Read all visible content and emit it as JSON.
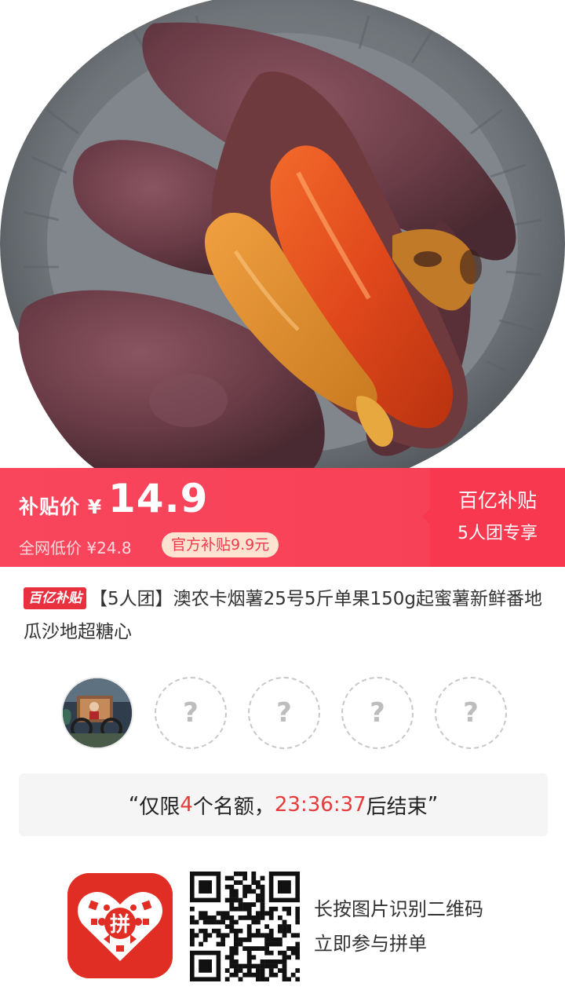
{
  "hero": {
    "image": "roasted-sweet-potatoes-on-tray"
  },
  "banner": {
    "subsidy_label": "补贴价",
    "currency": "¥",
    "price": "14.9",
    "market_label": "全网低价",
    "market_price": "¥24.8",
    "official_badge": "官方补贴9.9元",
    "program_title": "百亿补贴",
    "group_label": "5人团专享"
  },
  "product": {
    "badge": "百亿补贴",
    "title": "【5人团】澳农卡烟薯25号5斤单果150g起蜜薯新鲜番地瓜沙地超糖心"
  },
  "group": {
    "joined": 1,
    "slots": 5,
    "empty_mark": "?"
  },
  "notice": {
    "open_quote": "“",
    "prefix": "仅限",
    "count": "4",
    "middle": "个名额，",
    "timer": "23:36:37",
    "suffix": "后结束",
    "close_quote": "”"
  },
  "footer": {
    "app_icon": "pinduoduo-logo",
    "logo_text": "拼",
    "qr_icon": "qr-code",
    "hint_line1": "长按图片识别二维码",
    "hint_line2": "立即参与拼单"
  },
  "colors": {
    "brand_red": "#f9465c",
    "accent_red": "#e83a3a",
    "app_red": "#e02e24"
  }
}
